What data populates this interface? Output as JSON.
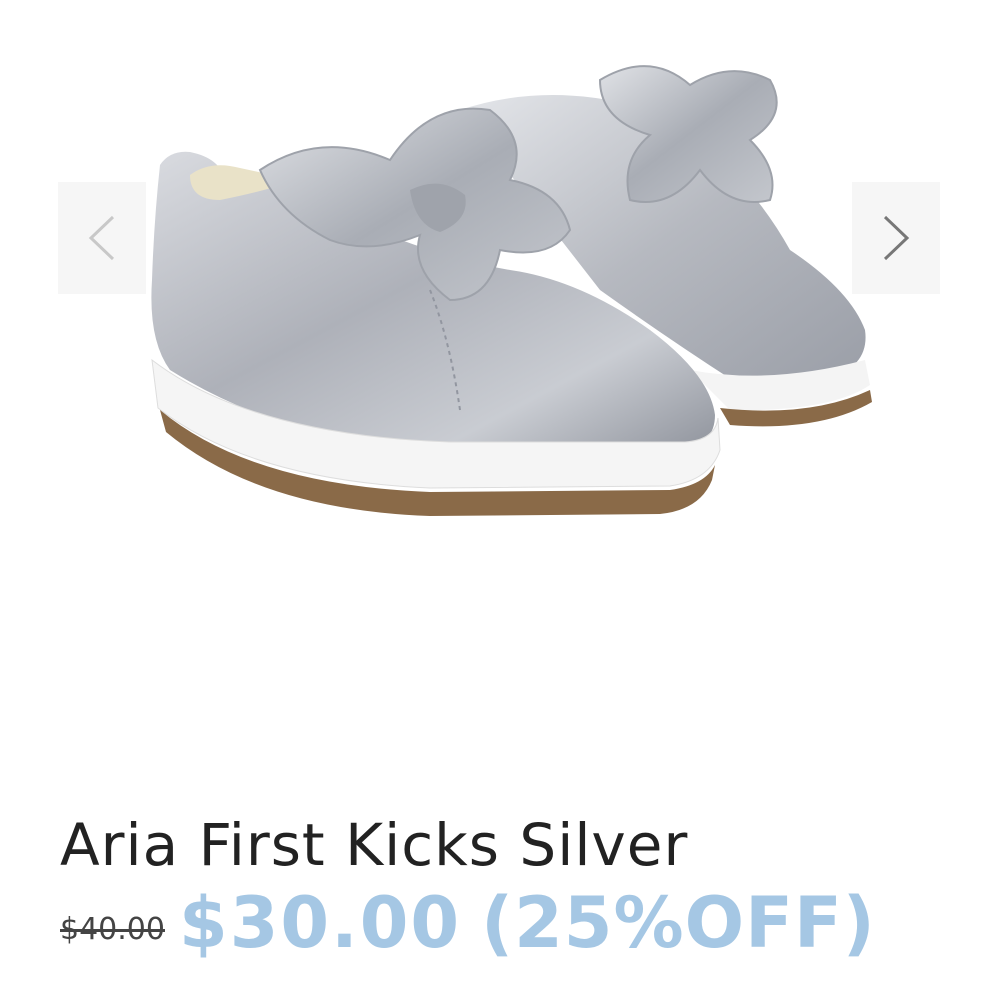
{
  "gallery": {
    "image_alt": "Aria First Kicks Silver shoes",
    "prev_icon": "chevron-left-icon",
    "next_icon": "chevron-right-icon"
  },
  "product": {
    "title": "Aria First Kicks Silver",
    "original_price": "$40.00",
    "sale_price": "$30.00",
    "discount_label": "(25%OFF)"
  },
  "colors": {
    "accent_price": "#a5c7e4",
    "title_text": "#222222",
    "shoe_silver": "#b9bcc3",
    "sole": "#8a6a48"
  }
}
